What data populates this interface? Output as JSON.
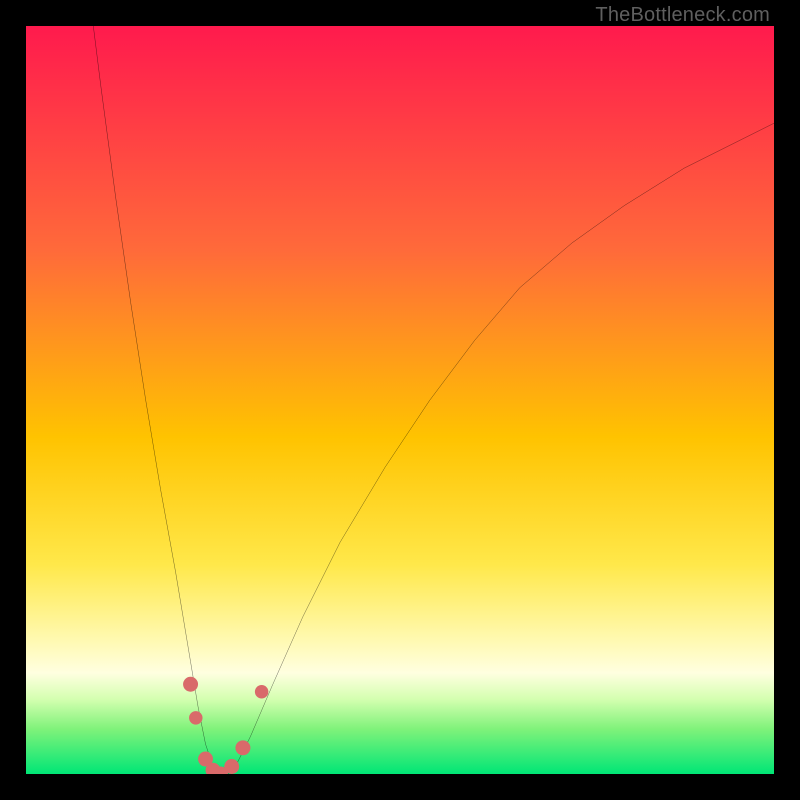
{
  "watermark": "TheBottleneck.com",
  "chart_data": {
    "type": "line",
    "title": "",
    "xlabel": "",
    "ylabel": "",
    "xlim": [
      0,
      100
    ],
    "ylim": [
      0,
      100
    ],
    "background_gradient": {
      "stops": [
        {
          "pos": 0.0,
          "color": "#ff1a4d"
        },
        {
          "pos": 0.3,
          "color": "#ff6a3a"
        },
        {
          "pos": 0.55,
          "color": "#ffc300"
        },
        {
          "pos": 0.72,
          "color": "#ffe84a"
        },
        {
          "pos": 0.82,
          "color": "#fff9b0"
        },
        {
          "pos": 0.865,
          "color": "#ffffe0"
        },
        {
          "pos": 0.9,
          "color": "#d4ffb0"
        },
        {
          "pos": 0.94,
          "color": "#7ff27a"
        },
        {
          "pos": 1.0,
          "color": "#00e676"
        }
      ]
    },
    "series": [
      {
        "name": "bottleneck-curve",
        "x": [
          9,
          10,
          12,
          14,
          16,
          18,
          20,
          21,
          22,
          23,
          24,
          25,
          26,
          27,
          28,
          30,
          33,
          37,
          42,
          48,
          54,
          60,
          66,
          73,
          80,
          88,
          96,
          100
        ],
        "y": [
          100,
          92,
          77,
          63,
          50,
          38,
          27,
          21,
          15,
          9,
          4,
          1,
          0,
          0,
          1,
          5,
          12,
          21,
          31,
          41,
          50,
          58,
          65,
          71,
          76,
          81,
          85,
          87
        ]
      }
    ],
    "markers": [
      {
        "x": 22.0,
        "y": 12.0,
        "r": 1.0
      },
      {
        "x": 22.7,
        "y": 7.5,
        "r": 0.9
      },
      {
        "x": 24.0,
        "y": 2.0,
        "r": 1.0
      },
      {
        "x": 25.0,
        "y": 0.5,
        "r": 1.0
      },
      {
        "x": 26.0,
        "y": 0.0,
        "r": 1.0
      },
      {
        "x": 27.5,
        "y": 1.0,
        "r": 1.0
      },
      {
        "x": 29.0,
        "y": 3.5,
        "r": 1.0
      },
      {
        "x": 31.5,
        "y": 11.0,
        "r": 0.9
      }
    ]
  }
}
